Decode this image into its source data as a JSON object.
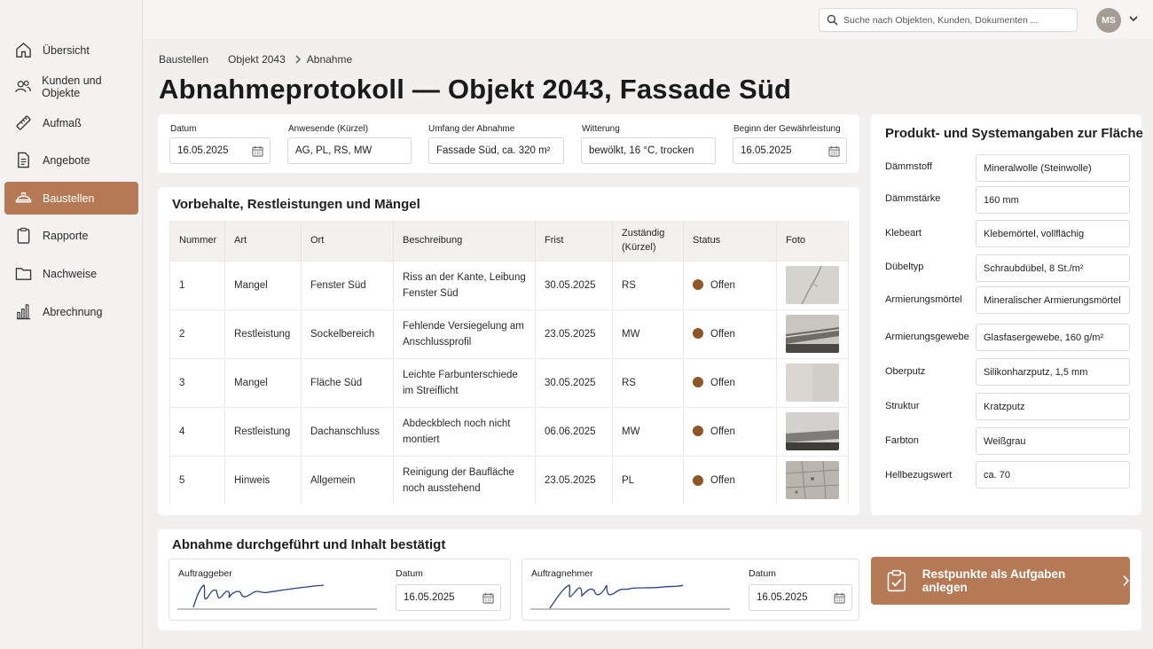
{
  "sidebar": {
    "items": [
      {
        "label": "Übersicht",
        "icon": "home-icon"
      },
      {
        "label": "Kunden und Objekte",
        "icon": "users-icon"
      },
      {
        "label": "Aufmaß",
        "icon": "ruler-icon"
      },
      {
        "label": "Angebote",
        "icon": "document-icon"
      },
      {
        "label": "Baustellen",
        "icon": "construction-icon",
        "active": true
      },
      {
        "label": "Rapporte",
        "icon": "clipboard-icon"
      },
      {
        "label": "Nachweise",
        "icon": "folder-icon"
      },
      {
        "label": "Abrechnung",
        "icon": "bar-chart-icon"
      }
    ]
  },
  "topbar": {
    "search_placeholder": "Suche nach Objekten, Kunden, Dokumenten ...",
    "avatar_initials": "MS"
  },
  "breadcrumb": {
    "items": [
      "Baustellen",
      "Objekt 2043",
      "Abnahme"
    ]
  },
  "page_title": "Abnahmeprotokoll — Objekt 2043, Fassade Süd",
  "header_fields": {
    "datum_label": "Datum",
    "datum_value": "16.05.2025",
    "anwesende_label": "Anwesende (Kürzel)",
    "anwesende_value": "AG, PL, RS, MW",
    "umfang_label": "Umfang der Abnahme",
    "umfang_value": "Fassade Süd, ca. 320 m²",
    "witterung_label": "Witterung",
    "witterung_value": "bewölkt, 16 °C, trocken",
    "gewaehr_label": "Beginn der Gewährleistung",
    "gewaehr_value": "16.05.2025"
  },
  "defects": {
    "title": "Vorbehalte, Restleistungen und Mängel",
    "columns": {
      "nummer": "Nummer",
      "art": "Art",
      "ort": "Ort",
      "beschreibung": "Beschreibung",
      "frist": "Frist",
      "zustaendig": "Zuständig (Kürzel)",
      "status": "Status",
      "foto": "Foto"
    },
    "rows": [
      {
        "nummer": "1",
        "art": "Mangel",
        "ort": "Fenster Süd",
        "beschreibung": "Riss an der Kante, Leibung Fenster Süd",
        "frist": "30.05.2025",
        "zustaendig": "RS",
        "status": "Offen",
        "foto": "crack-photo"
      },
      {
        "nummer": "2",
        "art": "Restleistung",
        "ort": "Sockelbereich",
        "beschreibung": "Fehlende Versiegelung am Anschlussprofil",
        "frist": "23.05.2025",
        "zustaendig": "MW",
        "status": "Offen",
        "foto": "profile-photo"
      },
      {
        "nummer": "3",
        "art": "Mangel",
        "ort": "Fläche Süd",
        "beschreibung": "Leichte Farbunterschiede im Streiflicht",
        "frist": "30.05.2025",
        "zustaendig": "RS",
        "status": "Offen",
        "foto": "plaster-photo"
      },
      {
        "nummer": "4",
        "art": "Restleistung",
        "ort": "Dachanschluss",
        "beschreibung": "Abdeckblech noch nicht montiert",
        "frist": "06.06.2025",
        "zustaendig": "MW",
        "status": "Offen",
        "foto": "flashing-photo"
      },
      {
        "nummer": "5",
        "art": "Hinweis",
        "ort": "Allgemein",
        "beschreibung": "Reinigung der Baufläche noch ausstehend",
        "frist": "23.05.2025",
        "zustaendig": "PL",
        "status": "Offen",
        "foto": "paving-photo"
      }
    ],
    "status_color": "#8f5628"
  },
  "product": {
    "title": "Produkt- und Systemangaben zur Fläche",
    "rows": [
      {
        "label": "Dämmstoff",
        "value": "Mineralwolle (Steinwolle)"
      },
      {
        "label": "Dämmstärke",
        "value": "160 mm"
      },
      {
        "label": "Klebeart",
        "value": "Klebemörtel, vollflächig"
      },
      {
        "label": "Dübeltyp",
        "value": "Schraubdübel, 8 St./m²"
      },
      {
        "label": "Armierungsmörtel",
        "value": "Mineralischer Armierungsmörtel"
      },
      {
        "label": "Armierungsgewebe",
        "value": "Glasfasergewebe, 160 g/m²"
      },
      {
        "label": "Oberputz",
        "value": "Silikonharzputz, 1,5 mm"
      },
      {
        "label": "Struktur",
        "value": "Kratzputz"
      },
      {
        "label": "Farbton",
        "value": "Weißgrau"
      },
      {
        "label": "Hellbezugswert",
        "value": "ca. 70"
      }
    ]
  },
  "confirmation": {
    "title": "Abnahme durchgeführt und Inhalt bestätigt",
    "auftraggeber_label": "Auftraggeber",
    "auftraggeber_datum_label": "Datum",
    "auftraggeber_datum_value": "16.05.2025",
    "auftragnehmer_label": "Auftragnehmer",
    "auftragnehmer_datum_label": "Datum",
    "auftragnehmer_datum_value": "16.05.2025"
  },
  "action": {
    "label": "Restpunkte als Aufgaben anlegen",
    "icon": "clipboard-check-icon"
  },
  "colors": {
    "accent": "#b57a55",
    "status_dot": "#8f5628",
    "signature_ink": "#2b3f86"
  }
}
